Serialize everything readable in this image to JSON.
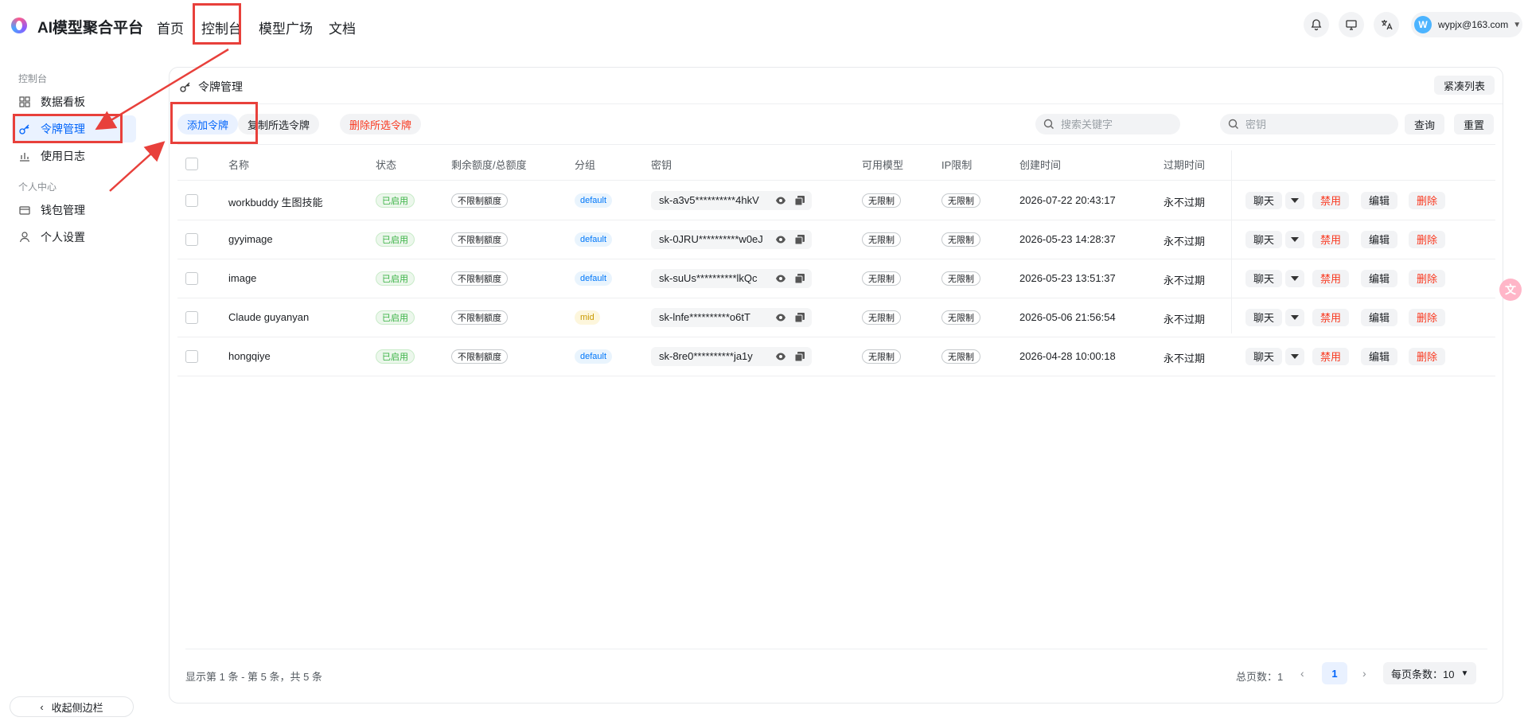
{
  "header": {
    "brand": "AI模型聚合平台",
    "nav": [
      "首页",
      "控制台",
      "模型广场",
      "文档"
    ],
    "user_initial": "W",
    "user_email": "wypjx@163.com"
  },
  "sidebar": {
    "section_console": "控制台",
    "items_console": [
      "数据看板",
      "令牌管理",
      "使用日志"
    ],
    "section_personal": "个人中心",
    "items_personal": [
      "钱包管理",
      "个人设置"
    ],
    "collapse_label": "收起侧边栏"
  },
  "card": {
    "title": "令牌管理",
    "compact_label": "紧凑列表",
    "add_label": "添加令牌",
    "copy_selected_label": "复制所选令牌",
    "delete_selected_label": "删除所选令牌",
    "search_keyword_placeholder": "搜索关键字",
    "search_key_placeholder": "密钥",
    "query_label": "查询",
    "reset_label": "重置"
  },
  "table": {
    "columns": [
      "名称",
      "状态",
      "剩余额度/总额度",
      "分组",
      "密钥",
      "可用模型",
      "IP限制",
      "创建时间",
      "过期时间"
    ],
    "rows": [
      {
        "name": "workbuddy 生图技能",
        "status": "已启用",
        "quota": "不限制额度",
        "group": "default",
        "key": "sk-a3v5**********4hkV",
        "models": "无限制",
        "ip": "无限制",
        "created": "2026-07-22 20:43:17",
        "expires": "永不过期"
      },
      {
        "name": "gyyimage",
        "status": "已启用",
        "quota": "不限制额度",
        "group": "default",
        "key": "sk-0JRU**********w0eJ",
        "models": "无限制",
        "ip": "无限制",
        "created": "2026-05-23 14:28:37",
        "expires": "永不过期"
      },
      {
        "name": "image",
        "status": "已启用",
        "quota": "不限制额度",
        "group": "default",
        "key": "sk-suUs**********lkQc",
        "models": "无限制",
        "ip": "无限制",
        "created": "2026-05-23 13:51:37",
        "expires": "永不过期"
      },
      {
        "name": "Claude guyanyan",
        "status": "已启用",
        "quota": "不限制额度",
        "group": "mid",
        "key": "sk-lnfe**********o6tT",
        "models": "无限制",
        "ip": "无限制",
        "created": "2026-05-06 21:56:54",
        "expires": "永不过期"
      },
      {
        "name": "hongqiye",
        "status": "已启用",
        "quota": "不限制额度",
        "group": "default",
        "key": "sk-8re0**********ja1y",
        "models": "无限制",
        "ip": "无限制",
        "created": "2026-04-28 10:00:18",
        "expires": "永不过期"
      }
    ],
    "actions": {
      "chat": "聊天",
      "disable": "禁用",
      "edit": "编辑",
      "delete": "删除"
    }
  },
  "footer": {
    "range_text": "显示第 1 条 - 第 5 条，共 5 条",
    "total_pages_text": "总页数：1",
    "current_page": "1",
    "page_size_text": "每页条数：10"
  },
  "colors": {
    "accent": "#0064fa",
    "danger": "#f93920",
    "annotation": "#e8403b"
  }
}
